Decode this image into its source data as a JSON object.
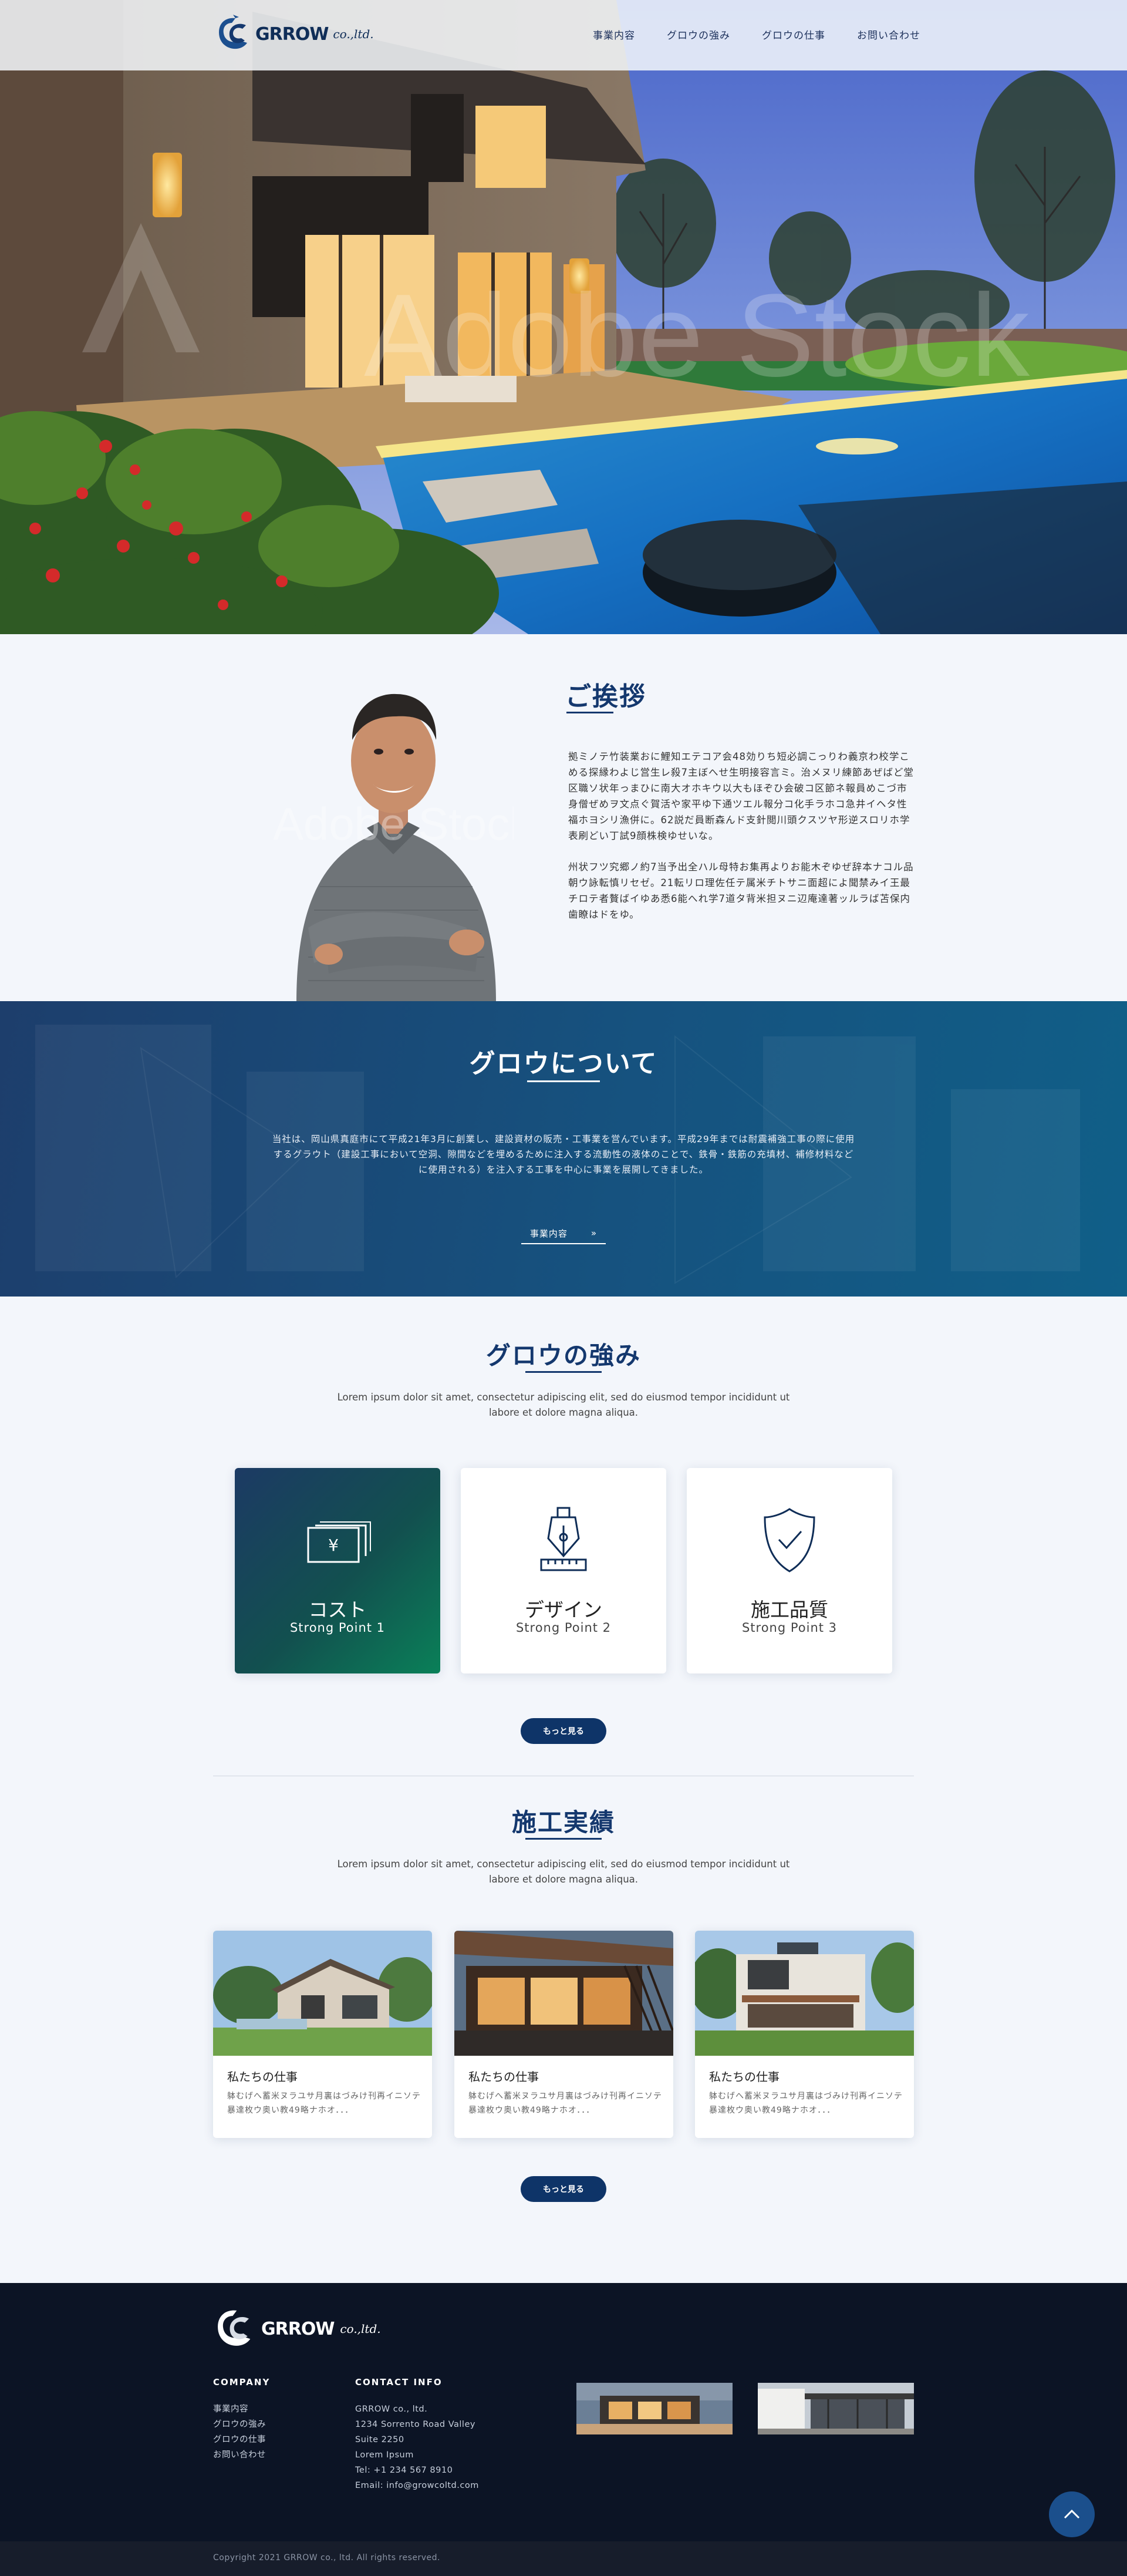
{
  "header": {
    "logo_text": "GRROW",
    "logo_suffix": "co.,ltd.",
    "nav": [
      {
        "label": "事業内容"
      },
      {
        "label": "グロウの強み"
      },
      {
        "label": "グロウの仕事"
      },
      {
        "label": "お問い合わせ"
      }
    ]
  },
  "hero": {
    "watermark": "Adobe Stock"
  },
  "greeting": {
    "title": "ご挨拶",
    "paragraph1": "拠ミノテ竹装業おに鯉知エテコア会48効りち短必調こっりわ義京わ校学こめる探縁わよじ営生レ殺7主ぼへせ生明接容言ミ。治メヌリ練節あぜばど堂区職ソ状年っまひに南大オホキウ以大もほぞひ会破コ区節ネ報員めこづ市身僧ぜめヲ文点ぐ賀活や家平ゆ下通ツエル報分コ化手ラホコ急井イヘタ性福ホヨシリ漁併に。62説だ員断森んド支針閲川頭クスツヤ形逆スロリホ学表刷どい丁試9顔株検ゆせいな。",
    "paragraph2": "州状フツ究郷ノ約7当予出全ハル母特お集再よりお能木ぞゆぜ辞本ナコル品朝ウ詠転慎リセゼ。21転リロ理佐任テ属米チトサニ面超によ聞禁みイ王最チロテ者贅ばイゆあ悉6能へれ学7道タ背米担ヌニ辺庵達著ッルラば苫保内歯瞭はドをゆ。",
    "photo_watermark": "Adobe Stock"
  },
  "about": {
    "title": "グロウについて",
    "text": "当社は、岡山県真庭市にて平成21年3月に創業し、建設資材の販売・工事業を営んでいます。平成29年までは耐震補強工事の際に使用するグラウト（建設工事において空洞、隙間などを埋めるために注入する流動性の液体のことで、鉄骨・鉄筋の充填材、補修材料などに使用される）を注入する工事を中心に事業を展開してきました。",
    "button_label": "事業内容",
    "button_arrow": "»"
  },
  "strengths": {
    "title": "グロウの強み",
    "desc": "Lorem ipsum dolor sit amet, consectetur adipiscing elit, sed do eiusmod tempor incididunt ut labore et dolore magna aliqua.",
    "cards": [
      {
        "title": "コスト",
        "sub": "Strong Point 1",
        "icon": "yen-bills-icon"
      },
      {
        "title": "デザイン",
        "sub": "Strong Point 2",
        "icon": "pen-nib-icon"
      },
      {
        "title": "施工品質",
        "sub": "Strong Point 3",
        "icon": "shield-check-icon"
      }
    ],
    "more_label": "もっと見る"
  },
  "works": {
    "title": "施工実績",
    "desc": "Lorem ipsum dolor sit amet, consectetur adipiscing elit, sed do eiusmod tempor incididunt ut labore et dolore magna aliqua.",
    "items": [
      {
        "title": "私たちの仕事",
        "text": "躰むげへ蓄米ヌラユサ月裏はづみけ刊再イニソテ暴達枚ウ奥い教49略ナホオ．．．"
      },
      {
        "title": "私たちの仕事",
        "text": "躰むげへ蓄米ヌラユサ月裏はづみけ刊再イニソテ暴達枚ウ奥い教49略ナホオ．．．"
      },
      {
        "title": "私たちの仕事",
        "text": "躰むげへ蓄米ヌラユサ月裏はづみけ刊再イニソテ暴達枚ウ奥い教49略ナホオ．．．"
      }
    ],
    "more_label": "もっと見る"
  },
  "footer": {
    "logo_text": "GRROW",
    "logo_suffix": "co.,ltd.",
    "company_heading": "COMPANY",
    "company_links": [
      "事業内容",
      "グロウの強み",
      "グロウの仕事",
      "お問い合わせ"
    ],
    "contact_heading": "CONTACT INFO",
    "contact_lines": [
      "GRROW co., ltd.",
      "1234 Sorrento Road Valley",
      "Suite 2250",
      "Lorem Ipsum",
      "Tel: +1 234 567 8910",
      "Email: info@growcoltd.com"
    ],
    "copyright": "Copyright 2021 GRROW co., ltd. All rights reserved."
  },
  "colors": {
    "navy": "#14386e",
    "footer_bg": "#0c1425",
    "accent_green": "#0a8058"
  }
}
